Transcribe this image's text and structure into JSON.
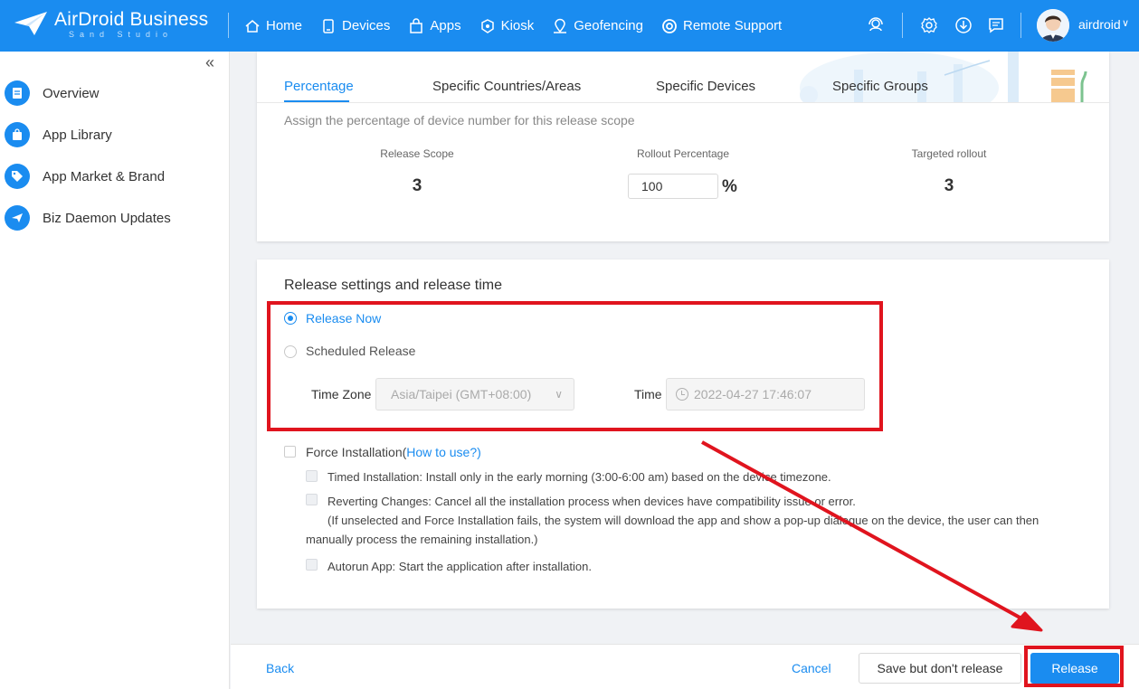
{
  "brand": {
    "name": "AirDroid Business",
    "sub": "Sand Studio"
  },
  "nav": [
    {
      "label": "Home",
      "icon": "home-icon"
    },
    {
      "label": "Devices",
      "icon": "device-icon"
    },
    {
      "label": "Apps",
      "icon": "apps-icon"
    },
    {
      "label": "Kiosk",
      "icon": "kiosk-icon"
    },
    {
      "label": "Geofencing",
      "icon": "geofence-icon"
    },
    {
      "label": "Remote Support",
      "icon": "lifebuoy-icon"
    }
  ],
  "user": {
    "name": "airdroid"
  },
  "sidebar": {
    "items": [
      {
        "label": "Overview",
        "icon": "document-icon"
      },
      {
        "label": "App Library",
        "icon": "bag-icon"
      },
      {
        "label": "App Market & Brand",
        "icon": "tag-icon"
      },
      {
        "label": "Biz Daemon Updates",
        "icon": "paper-plane-icon"
      }
    ]
  },
  "staged": {
    "tabs": [
      "Percentage",
      "Specific Countries/Areas",
      "Specific Devices",
      "Specific Groups"
    ],
    "active_tab": 0,
    "hint": "Assign the percentage of device number for this release scope",
    "cols": {
      "scope_label": "Release Scope",
      "scope_value": "3",
      "rollout_label": "Rollout Percentage",
      "rollout_value": "100",
      "rollout_unit": "%",
      "targeted_label": "Targeted rollout",
      "targeted_value": "3"
    }
  },
  "release": {
    "title": "Release settings and release time",
    "now_label": "Release Now",
    "scheduled_label": "Scheduled Release",
    "selected": "now",
    "timezone_label": "Time Zone",
    "timezone_value": "Asia/Taipei (GMT+08:00)",
    "time_label": "Time",
    "time_value": "2022-04-27 17:46:07"
  },
  "force": {
    "label": "Force Installation(",
    "link": "How to use?",
    "label_close": ")",
    "timed": "Timed Installation: Install only in the early morning (3:00-6:00 am) based on the device timezone.",
    "revert": "Reverting Changes: Cancel all the installation process when devices have compatibility issue or error.",
    "revert_note_1": "(If unselected and Force Installation fails, the system will download the app and show a pop-up dialogue on the device, the user can then",
    "revert_note_2": "manually process the remaining installation.)",
    "autorun": "Autorun App: Start the application after installation."
  },
  "footer": {
    "back": "Back",
    "cancel": "Cancel",
    "save": "Save but don't release",
    "release": "Release"
  },
  "colors": {
    "accent": "#1a8cf0",
    "highlight": "#e0141e"
  }
}
